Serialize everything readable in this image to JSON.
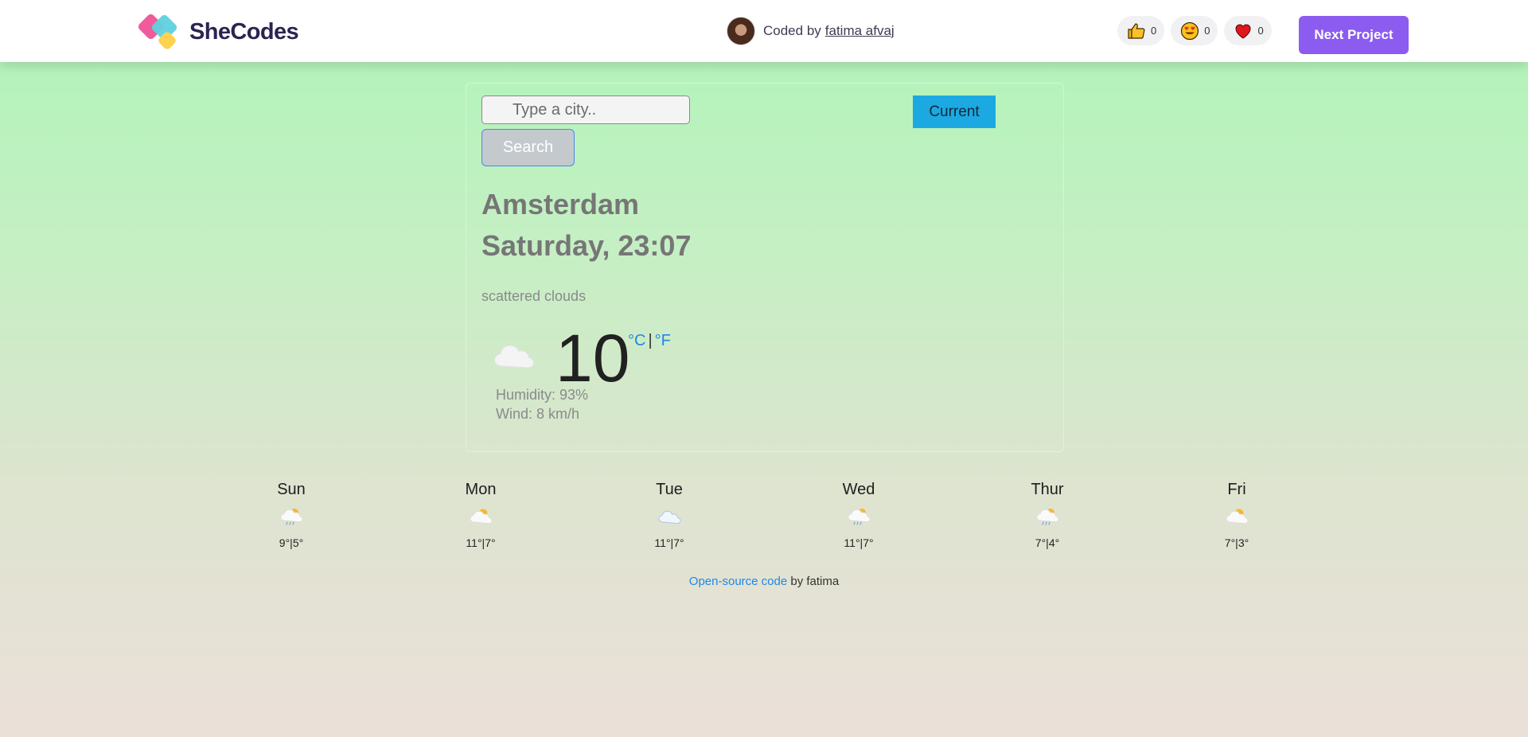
{
  "header": {
    "brand": "SheCodes",
    "coded_by_prefix": "Coded by",
    "author": "fatima afvaj",
    "reactions": [
      {
        "icon": "thumbs-up-icon",
        "count": "0"
      },
      {
        "icon": "heart-eyes-icon",
        "count": "0"
      },
      {
        "icon": "heart-icon",
        "count": "0"
      }
    ],
    "next_button": "Next Project"
  },
  "search": {
    "placeholder": "Type a city..",
    "button": "Search",
    "current_button": "Current"
  },
  "weather": {
    "city": "Amsterdam",
    "datetime": "Saturday, 23:07",
    "description": "scattered clouds",
    "icon": "cloud-icon",
    "temperature": "10",
    "unit_c": "°C",
    "unit_separator": "|",
    "unit_f": "°F",
    "humidity": "Humidity: 93%",
    "wind": "Wind: 8 km/h"
  },
  "forecast": [
    {
      "day": "Sun",
      "icon": "rain-cloud-icon",
      "temps": "9°|5°"
    },
    {
      "day": "Mon",
      "icon": "sun-cloud-icon",
      "temps": "11°|7°"
    },
    {
      "day": "Tue",
      "icon": "cloud-icon",
      "temps": "11°|7°"
    },
    {
      "day": "Wed",
      "icon": "rain-cloud-icon",
      "temps": "11°|7°"
    },
    {
      "day": "Thur",
      "icon": "rain-cloud-icon",
      "temps": "7°|4°"
    },
    {
      "day": "Fri",
      "icon": "sun-cloud-icon",
      "temps": "7°|3°"
    }
  ],
  "footer": {
    "link_text": "Open-source code",
    "suffix": "by fatima"
  },
  "colors": {
    "accent": "#8c5cf0",
    "current_button": "#1ca9e2",
    "link": "#1e88e5"
  }
}
